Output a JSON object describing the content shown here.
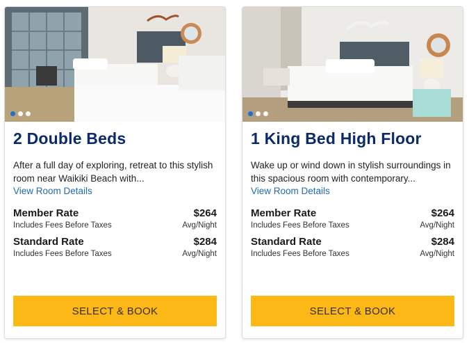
{
  "rooms": [
    {
      "title": "2 Double Beds",
      "description": "After a full day of exploring, retreat to this stylish room near Waikiki Beach with...",
      "details_link": "View Room Details",
      "rates": [
        {
          "name": "Member Rate",
          "price": "$264",
          "note": "Includes Fees Before Taxes",
          "unit": "Avg/Night"
        },
        {
          "name": "Standard Rate",
          "price": "$284",
          "note": "Includes Fees Before Taxes",
          "unit": "Avg/Night"
        }
      ],
      "button_label": "SELECT & BOOK",
      "carousel": {
        "total": 3,
        "active_index": 0
      }
    },
    {
      "title": "1 King Bed High Floor",
      "description": "Wake up or wind down in stylish surroundings in this spacious room with contemporary...",
      "details_link": "View Room Details",
      "rates": [
        {
          "name": "Member Rate",
          "price": "$264",
          "note": "Includes Fees Before Taxes",
          "unit": "Avg/Night"
        },
        {
          "name": "Standard Rate",
          "price": "$284",
          "note": "Includes Fees Before Taxes",
          "unit": "Avg/Night"
        }
      ],
      "button_label": "SELECT & BOOK",
      "carousel": {
        "total": 3,
        "active_index": 0
      }
    }
  ],
  "colors": {
    "title": "#0a2a6b",
    "link": "#1f6bb5",
    "button": "#fbb817",
    "carousel_active": "#1f6fd1"
  }
}
